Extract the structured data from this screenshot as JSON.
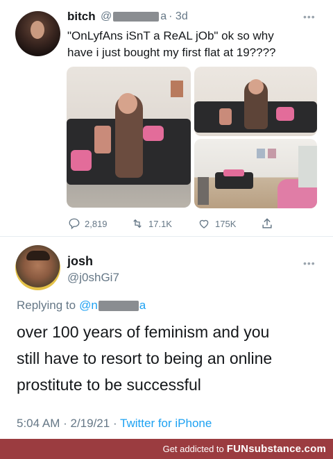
{
  "tweet1": {
    "author_name": "bitch",
    "handle_prefix": "@",
    "handle_suffix": "a",
    "time": "· 3d",
    "text_line1": "\"OnLyfAns iSnT a ReAL jOb\" ok so why",
    "text_line2": "have i just bought my first flat at 19????",
    "replies": "2,819",
    "retweets": "17.1K",
    "likes": "175K"
  },
  "tweet2": {
    "author_name": "josh",
    "handle": "@j0shGi7",
    "replying_prefix": "Replying to",
    "replying_handle": "@n",
    "replying_suffix": "a",
    "text_line1": "over 100 years of feminism and you",
    "text_line2": "still have to resort to being an online",
    "text_line3": "prostitute to be successful",
    "time": "5:04 AM",
    "date": "2/19/21",
    "source": "Twitter for iPhone"
  },
  "footer": {
    "prefix": "Get addicted to ",
    "brand": "FUNsubstance.com"
  },
  "colors": {
    "link": "#1da1f2",
    "footer_bg": "#9b3c40",
    "muted": "#657786"
  }
}
